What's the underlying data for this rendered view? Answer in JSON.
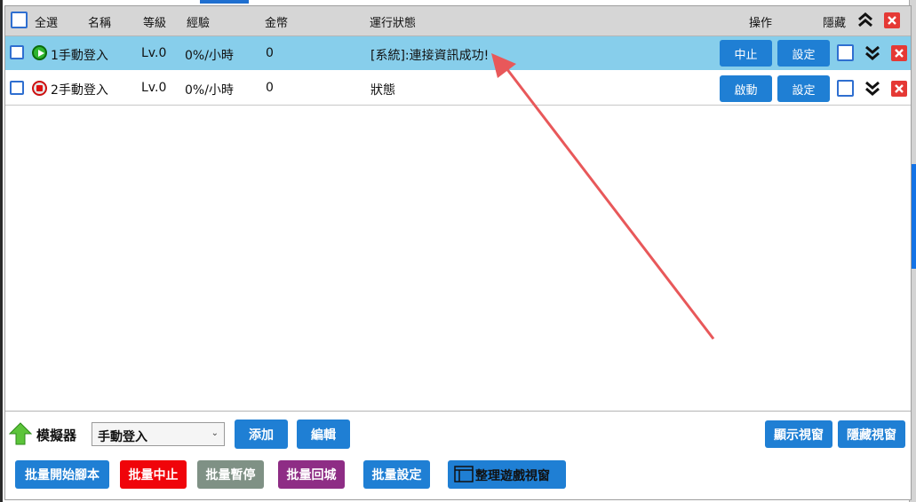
{
  "header": {
    "select_all": "全選",
    "name": "名稱",
    "level": "等級",
    "exp": "經驗",
    "coins": "金幣",
    "status": "運行狀態",
    "actions": "操作",
    "hide": "隱藏"
  },
  "rows": [
    {
      "state": "running",
      "name": "1手動登入",
      "level": "Lv.0",
      "exp": "0%/小時",
      "coins": "0",
      "status": "[系統]:連接資訊成功!",
      "primary_button": "中止",
      "settings_button": "設定"
    },
    {
      "state": "stopped",
      "name": "2手動登入",
      "level": "Lv.0",
      "exp": "0%/小時",
      "coins": "0",
      "status": "狀態",
      "primary_button": "啟動",
      "settings_button": "設定"
    }
  ],
  "emulator": {
    "label": "模擬器",
    "selected": "手動登入",
    "add_button": "添加",
    "edit_button": "編輯",
    "show_windows_button": "顯示視窗",
    "hide_windows_button": "隱藏視窗"
  },
  "batch": {
    "start": "批量開始腳本",
    "stop": "批量中止",
    "pause": "批量暫停",
    "return": "批量回城",
    "settings": "批量設定",
    "arrange": "整理遊戲視窗"
  },
  "colors": {
    "selected_row": "#87ceeb",
    "primary_blue": "#1f7fd4",
    "batch_stop_red": "#f0040a",
    "batch_pause_gray": "#7f9185",
    "batch_return_purple": "#8e2d85",
    "annotation_arrow": "#e8585a"
  }
}
